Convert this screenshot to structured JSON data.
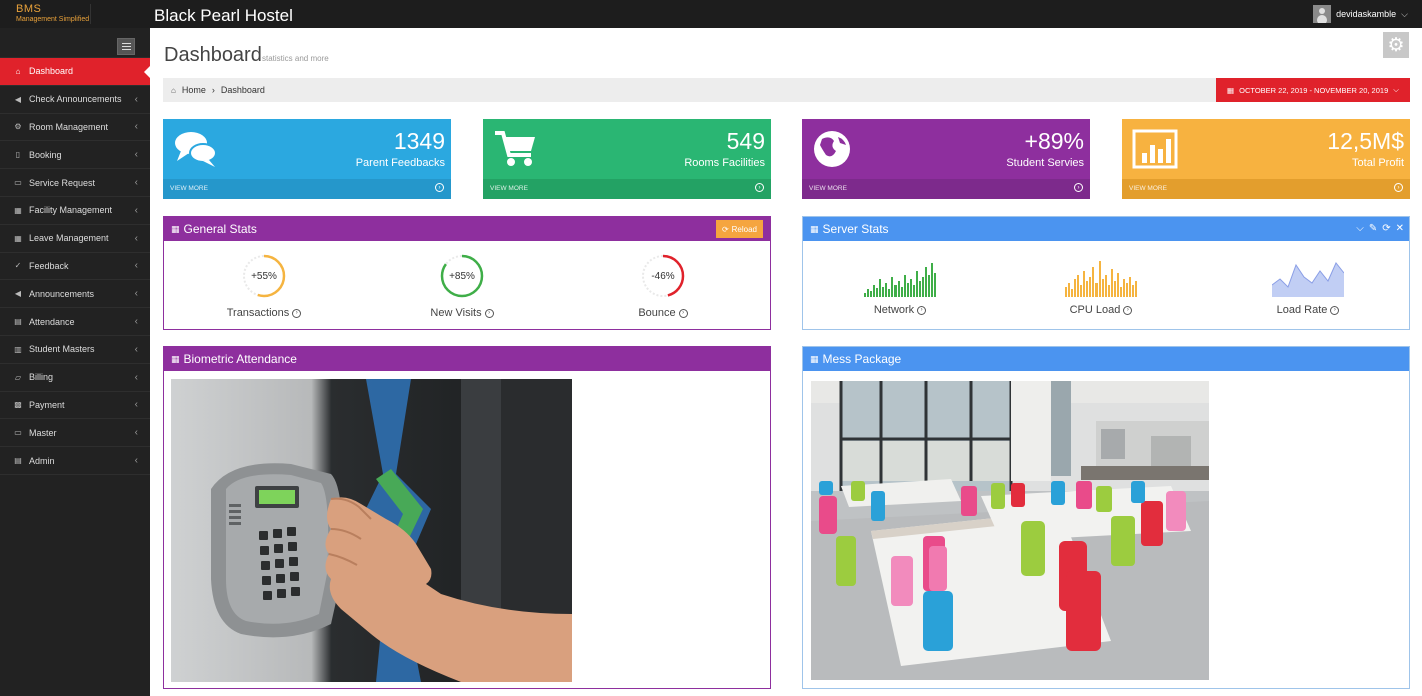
{
  "header": {
    "logo_text": "BMS",
    "logo_tagline": "Management Simplified",
    "app_title": "Black Pearl Hostel",
    "username": "devidaskamble",
    "user_chevron_icon": "chevron-down-icon"
  },
  "sidebar": {
    "items": [
      {
        "label": "Dashboard",
        "icon": "home-icon",
        "active": true
      },
      {
        "label": "Check Announcements",
        "icon": "bullhorn-icon"
      },
      {
        "label": "Room Management",
        "icon": "cogs-icon"
      },
      {
        "label": "Booking",
        "icon": "bookmark-icon"
      },
      {
        "label": "Service Request",
        "icon": "briefcase-icon"
      },
      {
        "label": "Facility Management",
        "icon": "table-icon"
      },
      {
        "label": "Leave Management",
        "icon": "table-icon"
      },
      {
        "label": "Feedback",
        "icon": "thumbs-up-icon"
      },
      {
        "label": "Announcements",
        "icon": "bullhorn-icon"
      },
      {
        "label": "Attendance",
        "icon": "file-icon"
      },
      {
        "label": "Student Masters",
        "icon": "bar-chart-icon"
      },
      {
        "label": "Billing",
        "icon": "folder-icon"
      },
      {
        "label": "Payment",
        "icon": "grid-icon"
      },
      {
        "label": "Master",
        "icon": "briefcase-icon"
      },
      {
        "label": "Admin",
        "icon": "file-icon"
      }
    ]
  },
  "page": {
    "title": "Dashboard",
    "subtitle": "statistics and more"
  },
  "breadcrumb": {
    "home": "Home",
    "current": "Dashboard",
    "date_range": "OCTOBER 22, 2019 - NOVEMBER 20, 2019"
  },
  "tiles": [
    {
      "value": "1349",
      "label": "Parent Feedbacks",
      "more": "VIEW MORE",
      "color": "#2ba8e0",
      "foot_color": "#2597cb",
      "icon": "comments-icon"
    },
    {
      "value": "549",
      "label": "Rooms Facilities",
      "more": "VIEW MORE",
      "color": "#2ab673",
      "foot_color": "#23a264",
      "icon": "shopping-cart-icon"
    },
    {
      "value": "+89%",
      "label": "Student Servies",
      "more": "VIEW MORE",
      "color": "#8e2f9e",
      "foot_color": "#7d2a8c",
      "icon": "globe-icon"
    },
    {
      "value": "12,5M$",
      "label": "Total Profit",
      "more": "VIEW MORE",
      "color": "#f7b240",
      "foot_color": "#e39e2d",
      "icon": "bar-chart-icon"
    }
  ],
  "general_stats": {
    "title": "General Stats",
    "reload_label": "Reload",
    "items": [
      {
        "pct": "+55%",
        "label": "Transactions",
        "fraction": 0.55,
        "color": "#f5b440"
      },
      {
        "pct": "+85%",
        "label": "New Visits",
        "fraction": 0.85,
        "color": "#3fae48"
      },
      {
        "pct": "-46%",
        "label": "Bounce",
        "fraction": 0.46,
        "color": "#e0222b"
      }
    ]
  },
  "server_stats": {
    "title": "Server Stats",
    "items": [
      {
        "label": "Network",
        "color": "#3fae48"
      },
      {
        "label": "CPU Load",
        "color": "#f5b440"
      },
      {
        "label": "Load Rate",
        "color": "#a7b9f0"
      }
    ]
  },
  "biometric": {
    "title": "Biometric Attendance"
  },
  "mess": {
    "title": "Mess Package"
  }
}
